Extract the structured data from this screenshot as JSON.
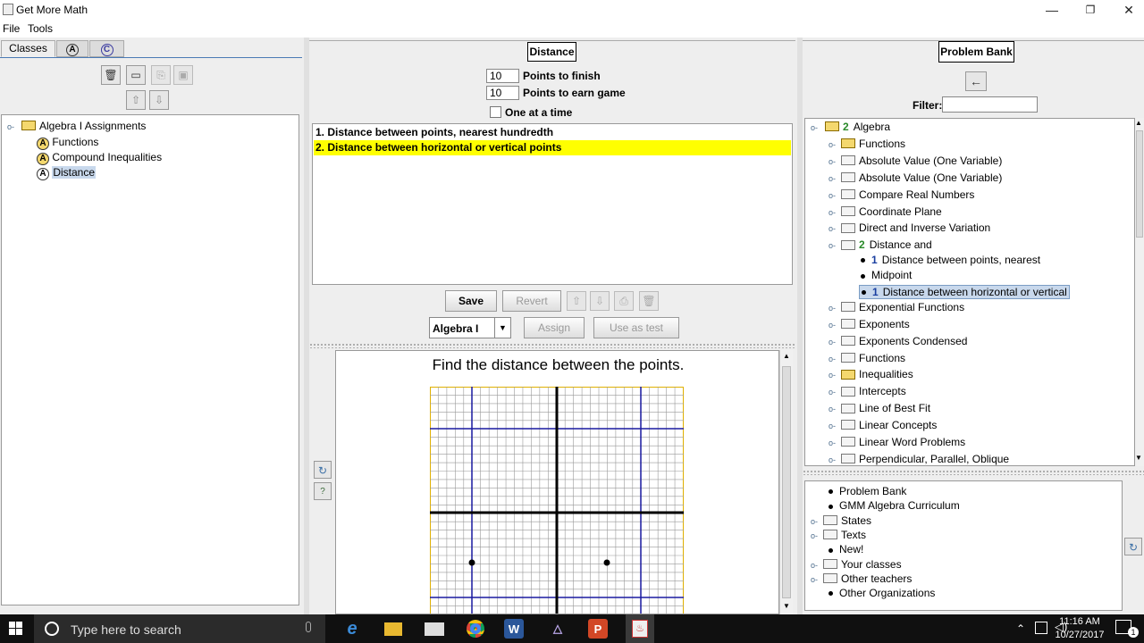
{
  "window": {
    "title": "Get More Math",
    "minimize": "—",
    "restore": "❐",
    "close": "✕"
  },
  "menu": {
    "file": "File",
    "tools": "Tools"
  },
  "left_panel": {
    "tabs": {
      "classes": "Classes",
      "tab_a": "A",
      "tab_c": "C"
    },
    "tree": {
      "root": "Algebra I Assignments",
      "items": [
        {
          "badge": "A",
          "label": "Functions"
        },
        {
          "badge": "A",
          "label": "Compound Inequalities"
        },
        {
          "badge": "A",
          "label": "Distance"
        }
      ]
    }
  },
  "assignment": {
    "title": "Distance",
    "points_to_finish": {
      "value": "10",
      "label": "Points to finish"
    },
    "points_to_earn_game": {
      "value": "10",
      "label": "Points to earn game"
    },
    "one_at_a_time": {
      "label": "One at a time",
      "checked": false
    },
    "problems": [
      "1. Distance between points, nearest hundredth",
      "2. Distance between horizontal or vertical points"
    ],
    "selected_index": 1,
    "buttons": {
      "save": "Save",
      "revert": "Revert",
      "assign": "Assign",
      "use_as_test": "Use as test"
    },
    "course_select": {
      "value": "Algebra I"
    },
    "highlight_color": "#ffff00"
  },
  "preview": {
    "question": "Find the distance between the points."
  },
  "problem_bank": {
    "title": "Problem Bank",
    "filter_label": "Filter:",
    "filter_value": "",
    "tree": {
      "root_count": "2",
      "root_label": "Algebra",
      "items": [
        {
          "label": "Functions",
          "pkg": true
        },
        {
          "label": "Absolute Value (One Variable)"
        },
        {
          "label": "Absolute Value (One Variable)"
        },
        {
          "label": "Compare Real Numbers"
        },
        {
          "label": "Coordinate Plane"
        },
        {
          "label": "Direct and Inverse Variation"
        },
        {
          "count": "2",
          "label": "Distance and",
          "open": true
        },
        {
          "leaf": true,
          "count": "1",
          "label": "Distance between points, nearest"
        },
        {
          "leaf": true,
          "label": "Midpoint"
        },
        {
          "leaf": true,
          "count": "1",
          "label": "Distance between horizontal or vertical",
          "selected": true
        },
        {
          "label": "Exponential Functions"
        },
        {
          "label": "Exponents"
        },
        {
          "label": "Exponents Condensed"
        },
        {
          "label": "Functions"
        },
        {
          "label": "Inequalities",
          "pkg": true
        },
        {
          "label": "Intercepts"
        },
        {
          "label": "Line of Best Fit"
        },
        {
          "label": "Linear Concepts"
        },
        {
          "label": "Linear Word Problems"
        },
        {
          "label": "Perpendicular, Parallel, Oblique"
        }
      ]
    },
    "sources": [
      {
        "label": "Problem Bank",
        "leaf": true
      },
      {
        "label": "GMM Algebra Curriculum",
        "leaf": true
      },
      {
        "label": "States"
      },
      {
        "label": "Texts"
      },
      {
        "label": "New!",
        "leaf": true
      },
      {
        "label": "Your classes"
      },
      {
        "label": "Other teachers"
      },
      {
        "label": "Other Organizations",
        "leaf": true
      }
    ]
  },
  "taskbar": {
    "search_placeholder": "Type here to search",
    "time": "11:16 AM",
    "date": "10/27/2017",
    "notif_count": "1"
  }
}
